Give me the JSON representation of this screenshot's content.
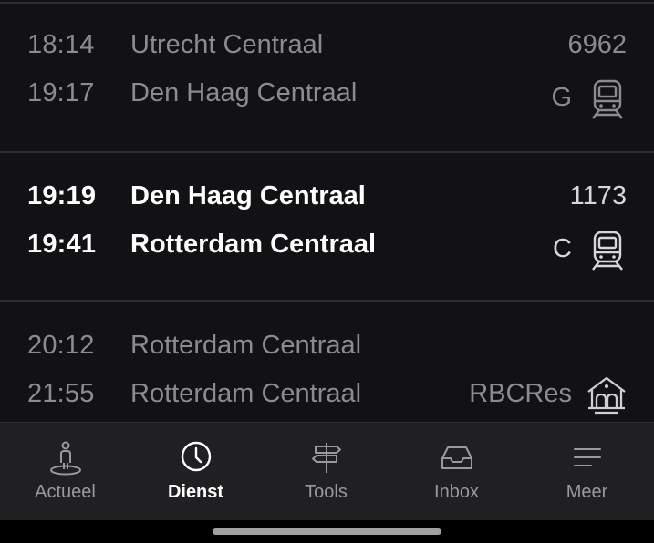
{
  "services": [
    {
      "dep_time": "18:14",
      "dep_station": "Utrecht Centraal",
      "arr_time": "19:17",
      "arr_station": "Den Haag Centraal",
      "number": "6962",
      "track": "G",
      "icon": "train-icon",
      "active": false
    },
    {
      "dep_time": "19:19",
      "dep_station": "Den Haag Centraal",
      "arr_time": "19:41",
      "arr_station": "Rotterdam Centraal",
      "number": "1173",
      "track": "C",
      "icon": "train-icon",
      "active": true
    },
    {
      "dep_time": "20:12",
      "dep_station": "Rotterdam Centraal",
      "arr_time": "21:55",
      "arr_station": "Rotterdam Centraal",
      "number": "",
      "track": "RBCRes",
      "icon": "station-building-icon",
      "active": false
    }
  ],
  "nav": {
    "items": [
      {
        "label": "Actueel",
        "icon": "person-standing-icon",
        "active": false
      },
      {
        "label": "Dienst",
        "icon": "clock-icon",
        "active": true
      },
      {
        "label": "Tools",
        "icon": "signpost-icon",
        "active": false
      },
      {
        "label": "Inbox",
        "icon": "inbox-tray-icon",
        "active": false
      },
      {
        "label": "Meer",
        "icon": "menu-lines-icon",
        "active": false
      }
    ]
  },
  "colors": {
    "background": "#121214",
    "nav_background": "#202022",
    "text_muted": "#8c8c8f",
    "text_active": "#ffffff",
    "separator": "#2e2e31"
  }
}
